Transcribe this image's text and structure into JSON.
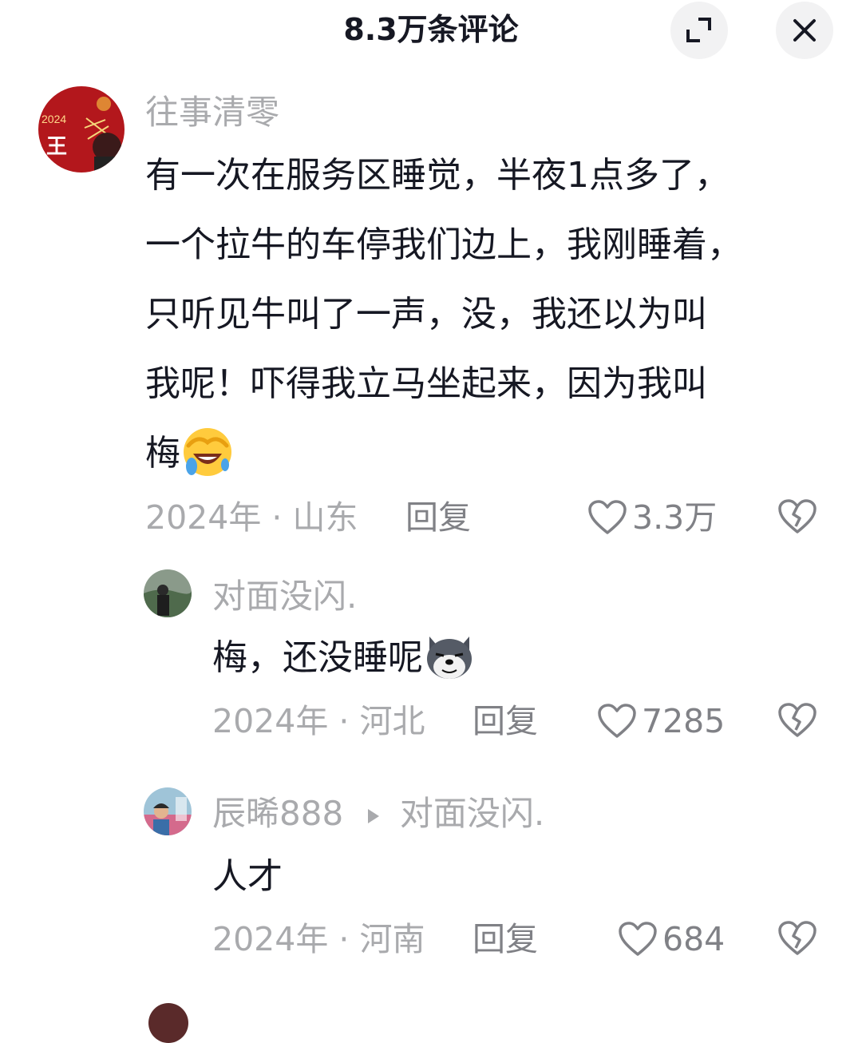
{
  "header": {
    "title": "8.3万条评论",
    "expand_icon": "expand-icon",
    "close_icon": "close-icon"
  },
  "comments": [
    {
      "username": "往事清零",
      "avatar_text": "2024",
      "avatar_char": "王",
      "lines": [
        "有一次在服务区睡觉，半夜1点多了，",
        "一个拉牛的车停我们边上，我刚睡着，",
        "只听见牛叫了一声，没，我还以为叫",
        "我呢！吓得我立马坐起来，因为我叫",
        "梅"
      ],
      "emoji": "laughing-crying-emoji",
      "time": "2024年",
      "separator": "·",
      "location": "山东",
      "reply_label": "回复",
      "likes": "3.3万"
    },
    {
      "username": "对面没闪.",
      "lines": [
        "梅，还没睡呢"
      ],
      "emoji": "husky-dog-emoji",
      "time": "2024年",
      "separator": "·",
      "location": "河北",
      "reply_label": "回复",
      "likes": "7285"
    },
    {
      "username": "辰晞888",
      "reply_to": "对面没闪.",
      "lines": [
        "人才"
      ],
      "time": "2024年",
      "separator": "·",
      "location": "河南",
      "reply_label": "回复",
      "likes": "684"
    }
  ],
  "colors": {
    "text": "#161823",
    "secondary": "#a9aaad",
    "action": "#808186",
    "button_bg": "#f2f2f3"
  }
}
